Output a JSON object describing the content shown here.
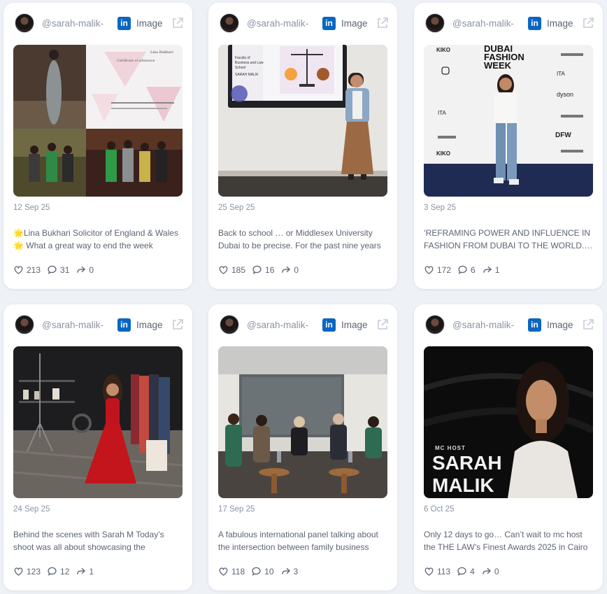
{
  "posts": [
    {
      "handle": "@sarah-malik-",
      "type_label": "Image",
      "date": "12 Sep 25",
      "text": "🌟Lina Bukhari Solicitor of England & Wales 🌟 What a great way to end the week",
      "likes": "213",
      "comments": "31",
      "shares": "0",
      "image_text": {
        "doc_line1": "Lina Bukhari",
        "doc_line2": "Certificate of admission"
      }
    },
    {
      "handle": "@sarah-malik-",
      "type_label": "Image",
      "date": "25 Sep 25",
      "text": "Back to school … or Middlesex University Dubai to be precise. For the past nine years",
      "likes": "185",
      "comments": "16",
      "shares": "0",
      "image_text": {
        "slide_line1": "Faculty of",
        "slide_line2": "Business and Law",
        "slide_line3": "School",
        "slide_line4": "SARAH MALIK"
      }
    },
    {
      "handle": "@sarah-malik-",
      "type_label": "Image",
      "date": "3 Sep 25",
      "text": "‘REFRAMING POWER AND INFLUENCE IN FASHION FROM DUBAI TO THE WORLD.’ I was",
      "likes": "172",
      "comments": "6",
      "shares": "1",
      "image_text": {
        "kiko": "KIKO",
        "dfw_line1": "DUBAI",
        "dfw_line2": "FASHION",
        "dfw_line3": "WEEK",
        "dyson": "dyson",
        "dfw": "DFW",
        "ita": "ITA"
      }
    },
    {
      "handle": "@sarah-malik-",
      "type_label": "Image",
      "date": "24 Sep 25",
      "text": "Behind the scenes with Sarah M Today’s shoot was all about showcasing the",
      "likes": "123",
      "comments": "12",
      "shares": "1"
    },
    {
      "handle": "@sarah-malik-",
      "type_label": "Image",
      "date": "17 Sep 25",
      "text": "A fabulous international panel talking about the intersection between family business",
      "likes": "118",
      "comments": "10",
      "shares": "3"
    },
    {
      "handle": "@sarah-malik-",
      "type_label": "Image",
      "date": "6 Oct 25",
      "text": "Only 12 days to go… Can’t wait to mc host the THE LAW’s Finest Awards 2025 in Cairo",
      "likes": "113",
      "comments": "4",
      "shares": "0",
      "image_text": {
        "mc_host": "MC HOST",
        "name_line1": "SARAH",
        "name_line2": "MALIK"
      }
    }
  ],
  "icons": {
    "network": "linkedin-icon",
    "external": "external-link-icon",
    "like": "heart-icon",
    "comment": "comment-icon",
    "share": "share-icon"
  },
  "colors": {
    "background": "#eef1f6",
    "card": "#ffffff",
    "linkedin": "#0a66c2",
    "muted_text": "#8b93a4",
    "body_text": "#5c6474"
  }
}
